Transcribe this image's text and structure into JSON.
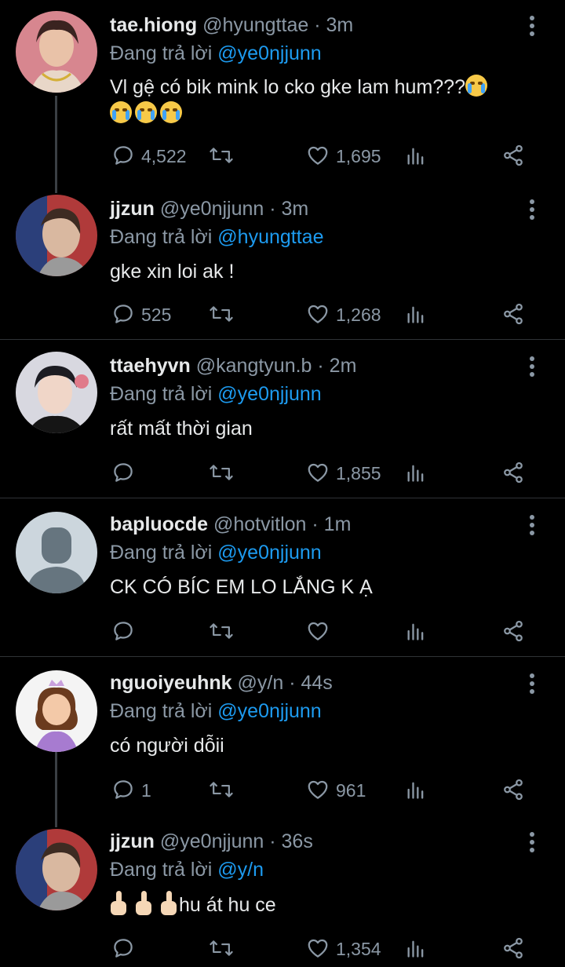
{
  "tweets": [
    {
      "name": "tae.hiong",
      "handle": "@hyungttae · 3m",
      "reply_prefix": "Đang trả lời",
      "reply_to": "@ye0njjunn",
      "text": "Vl gệ có bik mink lo cko gke lam hum???",
      "emoji_count": 4,
      "comments": "4,522",
      "retweets": "",
      "likes": "1,695",
      "avatar_color": "#c8737e"
    },
    {
      "name": "jjzun",
      "handle": "@ye0njjunn · 3m",
      "reply_prefix": "Đang trả lời",
      "reply_to": "@hyungttae",
      "text": "gke xin loi ak !",
      "comments": "525",
      "retweets": "",
      "likes": "1,268",
      "avatar_color": "#8a6b5a"
    },
    {
      "name": "ttaehyvn",
      "handle": "@kangtyun.b · 2m",
      "reply_prefix": "Đang trả lời",
      "reply_to": "@ye0njjunn",
      "text": "rất mất thời gian",
      "comments": "",
      "retweets": "",
      "likes": "1,855",
      "avatar_color": "#cfcfd6"
    },
    {
      "name": "bapluocde",
      "handle": "@hotvitlon · 1m",
      "reply_prefix": "Đang trả lời",
      "reply_to": "@ye0njjunn",
      "text": "CK CÓ BÍC EM LO LẮNG K Ạ",
      "comments": "",
      "retweets": "",
      "likes": "",
      "avatar_color": "#ccd6dd"
    },
    {
      "name": "nguoiyeuhnk",
      "handle": "@y/n · 44s",
      "reply_prefix": "Đang trả lời",
      "reply_to": "@ye0njjunn",
      "text": "có người dỗii",
      "comments": "1",
      "retweets": "",
      "likes": "961",
      "avatar_color": "#f2f2f2"
    },
    {
      "name": "jjzun",
      "handle": "@ye0njjunn · 36s",
      "reply_prefix": "Đang trả lời",
      "reply_to": "@y/n",
      "text": "hu át hu ce",
      "comments": "",
      "retweets": "",
      "likes": "1,354",
      "avatar_color": "#8a6b5a"
    }
  ],
  "colors": {
    "background": "#000000",
    "muted": "#8b98a5",
    "link": "#1d9bf0",
    "text": "#e7e9ea"
  },
  "icons": {
    "comment": "comment-icon",
    "retweet": "retweet-icon",
    "like": "heart-icon",
    "views": "views-icon",
    "share": "share-icon",
    "more": "more-vertical-icon"
  }
}
